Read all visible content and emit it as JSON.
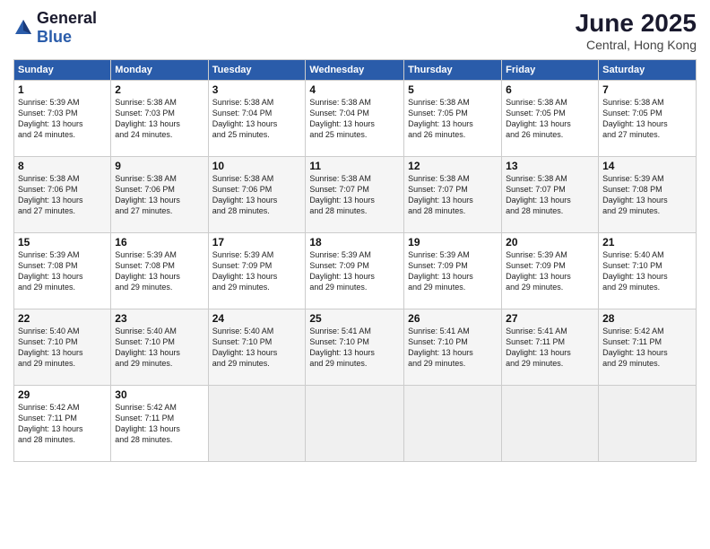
{
  "header": {
    "logo_general": "General",
    "logo_blue": "Blue",
    "month_year": "June 2025",
    "location": "Central, Hong Kong"
  },
  "weekdays": [
    "Sunday",
    "Monday",
    "Tuesday",
    "Wednesday",
    "Thursday",
    "Friday",
    "Saturday"
  ],
  "weeks": [
    [
      {
        "day": "1",
        "info": "Sunrise: 5:39 AM\nSunset: 7:03 PM\nDaylight: 13 hours\nand 24 minutes."
      },
      {
        "day": "2",
        "info": "Sunrise: 5:38 AM\nSunset: 7:03 PM\nDaylight: 13 hours\nand 24 minutes."
      },
      {
        "day": "3",
        "info": "Sunrise: 5:38 AM\nSunset: 7:04 PM\nDaylight: 13 hours\nand 25 minutes."
      },
      {
        "day": "4",
        "info": "Sunrise: 5:38 AM\nSunset: 7:04 PM\nDaylight: 13 hours\nand 25 minutes."
      },
      {
        "day": "5",
        "info": "Sunrise: 5:38 AM\nSunset: 7:05 PM\nDaylight: 13 hours\nand 26 minutes."
      },
      {
        "day": "6",
        "info": "Sunrise: 5:38 AM\nSunset: 7:05 PM\nDaylight: 13 hours\nand 26 minutes."
      },
      {
        "day": "7",
        "info": "Sunrise: 5:38 AM\nSunset: 7:05 PM\nDaylight: 13 hours\nand 27 minutes."
      }
    ],
    [
      {
        "day": "8",
        "info": "Sunrise: 5:38 AM\nSunset: 7:06 PM\nDaylight: 13 hours\nand 27 minutes."
      },
      {
        "day": "9",
        "info": "Sunrise: 5:38 AM\nSunset: 7:06 PM\nDaylight: 13 hours\nand 27 minutes."
      },
      {
        "day": "10",
        "info": "Sunrise: 5:38 AM\nSunset: 7:06 PM\nDaylight: 13 hours\nand 28 minutes."
      },
      {
        "day": "11",
        "info": "Sunrise: 5:38 AM\nSunset: 7:07 PM\nDaylight: 13 hours\nand 28 minutes."
      },
      {
        "day": "12",
        "info": "Sunrise: 5:38 AM\nSunset: 7:07 PM\nDaylight: 13 hours\nand 28 minutes."
      },
      {
        "day": "13",
        "info": "Sunrise: 5:38 AM\nSunset: 7:07 PM\nDaylight: 13 hours\nand 28 minutes."
      },
      {
        "day": "14",
        "info": "Sunrise: 5:39 AM\nSunset: 7:08 PM\nDaylight: 13 hours\nand 29 minutes."
      }
    ],
    [
      {
        "day": "15",
        "info": "Sunrise: 5:39 AM\nSunset: 7:08 PM\nDaylight: 13 hours\nand 29 minutes."
      },
      {
        "day": "16",
        "info": "Sunrise: 5:39 AM\nSunset: 7:08 PM\nDaylight: 13 hours\nand 29 minutes."
      },
      {
        "day": "17",
        "info": "Sunrise: 5:39 AM\nSunset: 7:09 PM\nDaylight: 13 hours\nand 29 minutes."
      },
      {
        "day": "18",
        "info": "Sunrise: 5:39 AM\nSunset: 7:09 PM\nDaylight: 13 hours\nand 29 minutes."
      },
      {
        "day": "19",
        "info": "Sunrise: 5:39 AM\nSunset: 7:09 PM\nDaylight: 13 hours\nand 29 minutes."
      },
      {
        "day": "20",
        "info": "Sunrise: 5:39 AM\nSunset: 7:09 PM\nDaylight: 13 hours\nand 29 minutes."
      },
      {
        "day": "21",
        "info": "Sunrise: 5:40 AM\nSunset: 7:10 PM\nDaylight: 13 hours\nand 29 minutes."
      }
    ],
    [
      {
        "day": "22",
        "info": "Sunrise: 5:40 AM\nSunset: 7:10 PM\nDaylight: 13 hours\nand 29 minutes."
      },
      {
        "day": "23",
        "info": "Sunrise: 5:40 AM\nSunset: 7:10 PM\nDaylight: 13 hours\nand 29 minutes."
      },
      {
        "day": "24",
        "info": "Sunrise: 5:40 AM\nSunset: 7:10 PM\nDaylight: 13 hours\nand 29 minutes."
      },
      {
        "day": "25",
        "info": "Sunrise: 5:41 AM\nSunset: 7:10 PM\nDaylight: 13 hours\nand 29 minutes."
      },
      {
        "day": "26",
        "info": "Sunrise: 5:41 AM\nSunset: 7:10 PM\nDaylight: 13 hours\nand 29 minutes."
      },
      {
        "day": "27",
        "info": "Sunrise: 5:41 AM\nSunset: 7:11 PM\nDaylight: 13 hours\nand 29 minutes."
      },
      {
        "day": "28",
        "info": "Sunrise: 5:42 AM\nSunset: 7:11 PM\nDaylight: 13 hours\nand 29 minutes."
      }
    ],
    [
      {
        "day": "29",
        "info": "Sunrise: 5:42 AM\nSunset: 7:11 PM\nDaylight: 13 hours\nand 28 minutes."
      },
      {
        "day": "30",
        "info": "Sunrise: 5:42 AM\nSunset: 7:11 PM\nDaylight: 13 hours\nand 28 minutes."
      },
      {
        "day": "",
        "info": ""
      },
      {
        "day": "",
        "info": ""
      },
      {
        "day": "",
        "info": ""
      },
      {
        "day": "",
        "info": ""
      },
      {
        "day": "",
        "info": ""
      }
    ]
  ]
}
